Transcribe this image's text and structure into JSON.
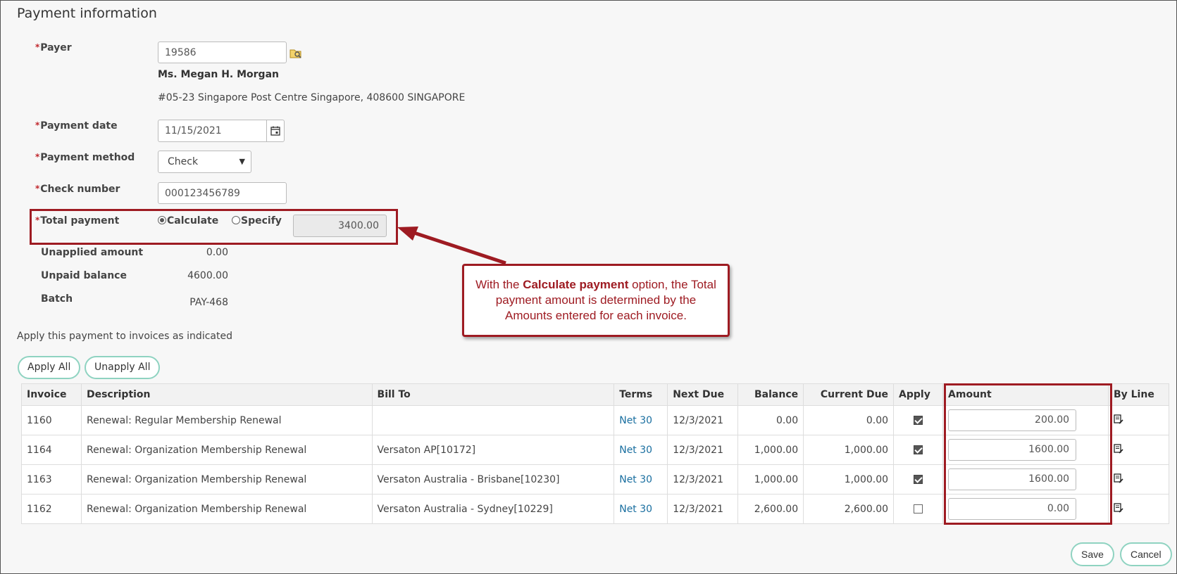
{
  "page": {
    "title": "Payment information"
  },
  "form": {
    "payer": {
      "label": "Payer",
      "value": "19586",
      "name": "Ms. Megan H. Morgan",
      "address": "#05-23 Singapore Post Centre Singapore, 408600 SINGAPORE"
    },
    "payment_date": {
      "label": "Payment date",
      "value": "11/15/2021"
    },
    "payment_method": {
      "label": "Payment method",
      "value": "Check"
    },
    "check_number": {
      "label": "Check number",
      "value": "000123456789"
    },
    "total_payment": {
      "label": "Total payment",
      "option_calculate": "Calculate",
      "option_specify": "Specify",
      "selected": "Calculate",
      "value": "3400.00"
    },
    "unapplied_amount": {
      "label": "Unapplied amount",
      "value": "0.00"
    },
    "unpaid_balance": {
      "label": "Unpaid balance",
      "value": "4600.00"
    },
    "batch": {
      "label": "Batch",
      "value": "PAY-468"
    }
  },
  "callout": {
    "text_before": "With the ",
    "text_bold": "Calculate payment",
    "text_after": " option, the Total payment amount is determined by the Amounts entered for each invoice."
  },
  "apply_section": {
    "caption": "Apply this payment to invoices as indicated",
    "apply_all_label": "Apply All",
    "unapply_all_label": "Unapply All"
  },
  "table": {
    "columns": [
      "Invoice",
      "Description",
      "Bill To",
      "Terms",
      "Next Due",
      "Balance",
      "Current Due",
      "Apply",
      "Amount",
      "By Line"
    ],
    "rows": [
      {
        "invoice": "1160",
        "description": "Renewal: Regular Membership Renewal",
        "bill_to": "",
        "terms": "Net 30",
        "next_due": "12/3/2021",
        "balance": "0.00",
        "current_due": "0.00",
        "apply": true,
        "amount": "200.00"
      },
      {
        "invoice": "1164",
        "description": "Renewal: Organization Membership Renewal",
        "bill_to": "Versaton AP[10172]",
        "terms": "Net 30",
        "next_due": "12/3/2021",
        "balance": "1,000.00",
        "current_due": "1,000.00",
        "apply": true,
        "amount": "1600.00"
      },
      {
        "invoice": "1163",
        "description": "Renewal: Organization Membership Renewal",
        "bill_to": "Versaton Australia - Brisbane[10230]",
        "terms": "Net 30",
        "next_due": "12/3/2021",
        "balance": "1,000.00",
        "current_due": "1,000.00",
        "apply": true,
        "amount": "1600.00"
      },
      {
        "invoice": "1162",
        "description": "Renewal: Organization Membership Renewal",
        "bill_to": "Versaton Australia - Sydney[10229]",
        "terms": "Net 30",
        "next_due": "12/3/2021",
        "balance": "2,600.00",
        "current_due": "2,600.00",
        "apply": false,
        "amount": "0.00"
      }
    ]
  },
  "footer": {
    "save_label": "Save",
    "cancel_label": "Cancel"
  },
  "colors": {
    "annotation": "#9e1b22",
    "required": "#c0272d",
    "link": "#1a6fa0",
    "pill_border": "#8fd3c1"
  }
}
